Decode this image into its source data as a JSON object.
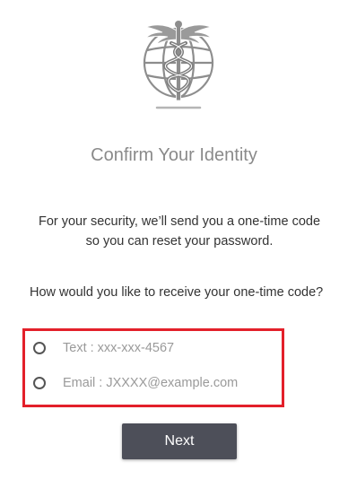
{
  "logo": {
    "icon": "caduceus-globe-icon"
  },
  "title": "Confirm Your Identity",
  "intro": "For your security, we’ll send you a one-time code so you can reset your password.",
  "question": "How would you like to receive your one-time code?",
  "options": [
    {
      "label": "Text : xxx-xxx-4567",
      "selected": false
    },
    {
      "label": "Email : JXXXX@example.com",
      "selected": false
    }
  ],
  "colors": {
    "highlight_border": "#e3202a",
    "button_bg": "#4d4f59",
    "title": "#8a8a8a",
    "option_text": "#9a9a9a"
  },
  "next_button": {
    "label": "Next"
  }
}
